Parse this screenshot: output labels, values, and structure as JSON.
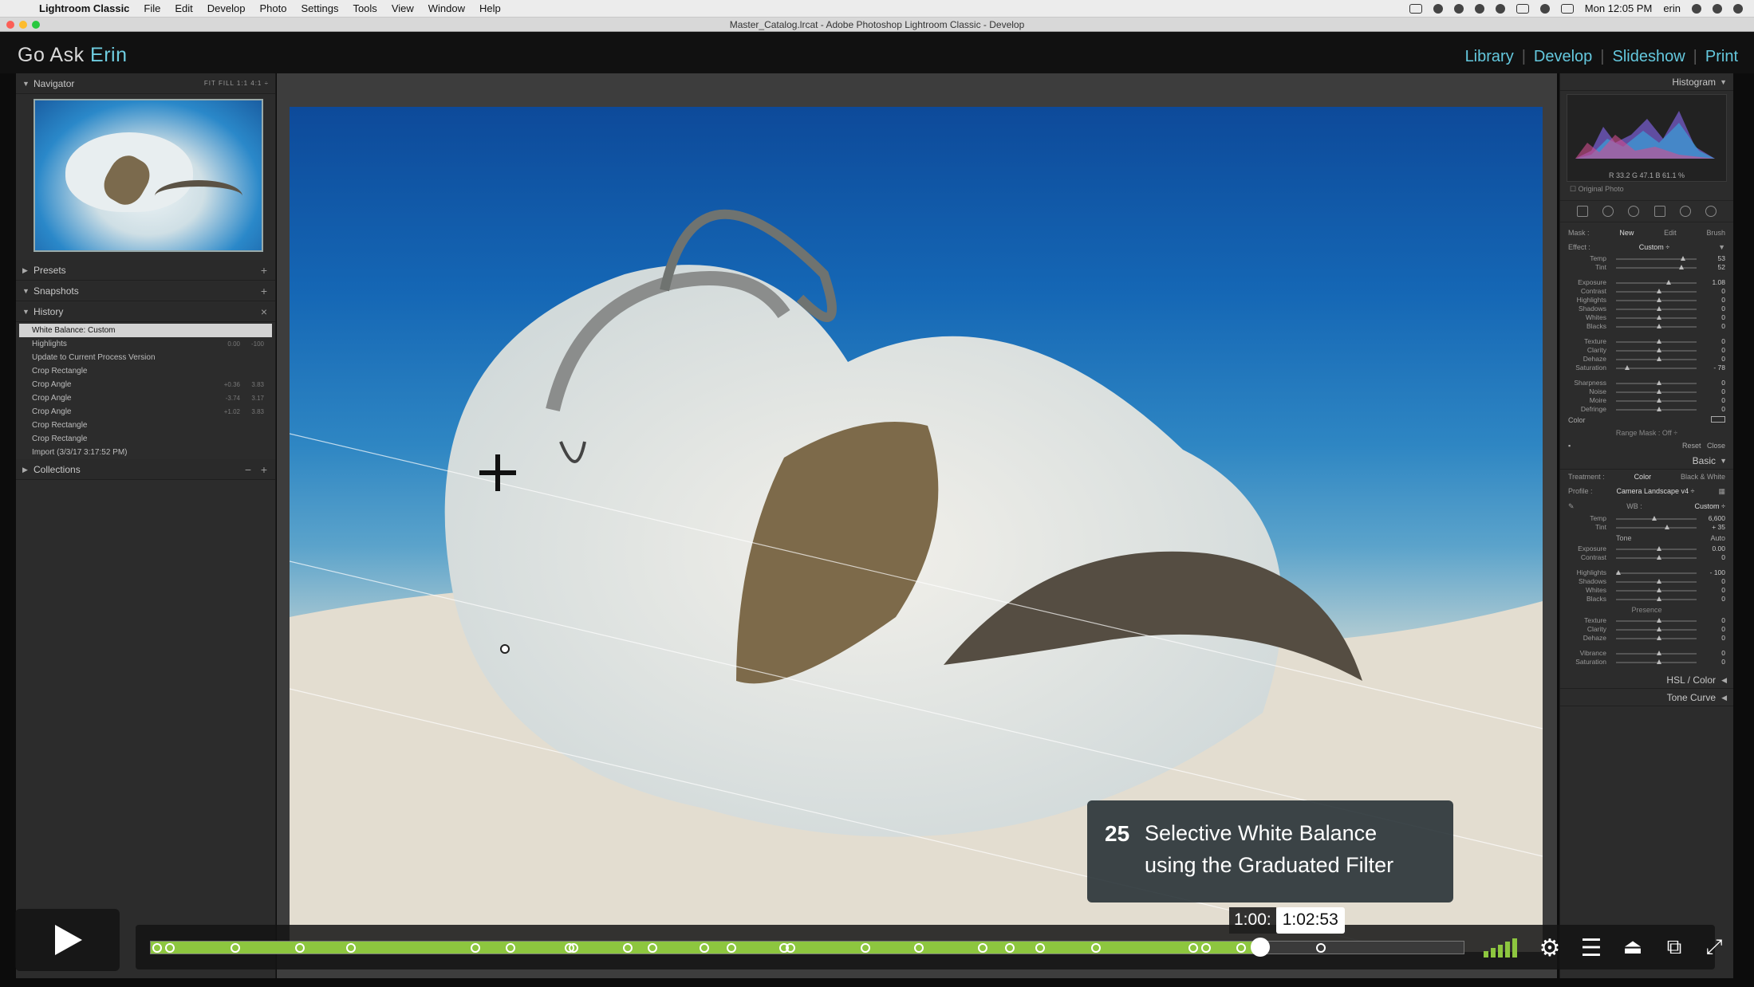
{
  "menubar": {
    "items": [
      "Lightroom Classic",
      "File",
      "Edit",
      "Develop",
      "Photo",
      "Settings",
      "Tools",
      "View",
      "Window",
      "Help"
    ],
    "clock": "Mon 12:05 PM",
    "user": "erin"
  },
  "window": {
    "title": "Master_Catalog.lrcat - Adobe Photoshop Lightroom Classic - Develop"
  },
  "identity": {
    "part1": "Go Ask ",
    "part2": "Erin"
  },
  "modules": [
    "Library",
    "Develop",
    "Slideshow",
    "Print"
  ],
  "left_panel": {
    "navigator": {
      "title": "Navigator",
      "zoom": "FIT  FILL  1:1  4:1 ÷"
    },
    "presets": "Presets",
    "snapshots": "Snapshots",
    "history": {
      "title": "History",
      "items": [
        {
          "label": "White Balance: Custom",
          "v1": "",
          "v2": ""
        },
        {
          "label": "Highlights",
          "v1": "0.00",
          "v2": "-100"
        },
        {
          "label": "Update to Current Process Version",
          "v1": "",
          "v2": ""
        },
        {
          "label": "Crop Rectangle",
          "v1": "",
          "v2": ""
        },
        {
          "label": "Crop Angle",
          "v1": "+0.36",
          "v2": "3.83"
        },
        {
          "label": "Crop Angle",
          "v1": "-3.74",
          "v2": "3.17"
        },
        {
          "label": "Crop Angle",
          "v1": "+1.02",
          "v2": "3.83"
        },
        {
          "label": "Crop Rectangle",
          "v1": "",
          "v2": ""
        },
        {
          "label": "Crop Rectangle",
          "v1": "",
          "v2": ""
        },
        {
          "label": "Import (3/3/17 3:17:52 PM)",
          "v1": "",
          "v2": ""
        }
      ]
    },
    "collections": "Collections"
  },
  "right_panel": {
    "histogram_title": "Histogram",
    "histogram_readout": "R  33.2   G  47.1   B  61.1 %",
    "original_photo": "Original Photo",
    "mask": {
      "label": "Mask :",
      "new": "New",
      "edit": "Edit",
      "brush": "Brush"
    },
    "effect": {
      "label": "Effect :",
      "value": "Custom ÷"
    },
    "sliders1": [
      {
        "label": "Temp",
        "value": "53",
        "pos": 0.8
      },
      {
        "label": "Tint",
        "value": "52",
        "pos": 0.78
      }
    ],
    "sliders2": [
      {
        "label": "Exposure",
        "value": "1.08",
        "pos": 0.62
      },
      {
        "label": "Contrast",
        "value": "0",
        "pos": 0.5
      },
      {
        "label": "Highlights",
        "value": "0",
        "pos": 0.5
      },
      {
        "label": "Shadows",
        "value": "0",
        "pos": 0.5
      },
      {
        "label": "Whites",
        "value": "0",
        "pos": 0.5
      },
      {
        "label": "Blacks",
        "value": "0",
        "pos": 0.5
      }
    ],
    "sliders3": [
      {
        "label": "Texture",
        "value": "0",
        "pos": 0.5
      },
      {
        "label": "Clarity",
        "value": "0",
        "pos": 0.5
      },
      {
        "label": "Dehaze",
        "value": "0",
        "pos": 0.5
      },
      {
        "label": "Saturation",
        "value": "- 78",
        "pos": 0.11
      }
    ],
    "sliders4": [
      {
        "label": "Sharpness",
        "value": "0",
        "pos": 0.5
      },
      {
        "label": "Noise",
        "value": "0",
        "pos": 0.5
      },
      {
        "label": "Moire",
        "value": "0",
        "pos": 0.5
      },
      {
        "label": "Defringe",
        "value": "0",
        "pos": 0.5
      }
    ],
    "color_label": "Color",
    "range_mask": "Range Mask : Off ÷",
    "reset": "Reset",
    "close": "Close",
    "basic_title": "Basic",
    "treatment": {
      "label": "Treatment :",
      "color": "Color",
      "bw": "Black & White"
    },
    "profile": {
      "label": "Profile :",
      "value": "Camera Landscape v4 ÷"
    },
    "wb": {
      "label": "WB :",
      "value": "Custom ÷"
    },
    "basic_sliders1": [
      {
        "label": "Temp",
        "value": "6,600",
        "pos": 0.45
      },
      {
        "label": "Tint",
        "value": "+ 35",
        "pos": 0.6
      }
    ],
    "tone_label": "Tone",
    "auto_label": "Auto",
    "basic_sliders2": [
      {
        "label": "Exposure",
        "value": "0.00",
        "pos": 0.5
      },
      {
        "label": "Contrast",
        "value": "0",
        "pos": 0.5
      }
    ],
    "basic_sliders3": [
      {
        "label": "Highlights",
        "value": "- 100",
        "pos": 0.0
      },
      {
        "label": "Shadows",
        "value": "0",
        "pos": 0.5
      },
      {
        "label": "Whites",
        "value": "0",
        "pos": 0.5
      },
      {
        "label": "Blacks",
        "value": "0",
        "pos": 0.5
      }
    ],
    "presence_label": "Presence",
    "basic_sliders4": [
      {
        "label": "Texture",
        "value": "0",
        "pos": 0.5
      },
      {
        "label": "Clarity",
        "value": "0",
        "pos": 0.5
      },
      {
        "label": "Dehaze",
        "value": "0",
        "pos": 0.5
      }
    ],
    "basic_sliders5": [
      {
        "label": "Vibrance",
        "value": "0",
        "pos": 0.5
      },
      {
        "label": "Saturation",
        "value": "0",
        "pos": 0.5
      }
    ],
    "hsl_title": "HSL / Color",
    "tone_curve_title": "Tone Curve"
  },
  "video": {
    "chapter_number": "25",
    "chapter_title_line1": "Selective White Balance",
    "chapter_title_line2": "using the Graduated Filter",
    "time_current": "1:00:",
    "time_hover": "1:02:53",
    "played_fraction": 0.845,
    "playhead_fraction": 0.845,
    "chapter_fractions": [
      0.0,
      0.01,
      0.06,
      0.11,
      0.149,
      0.245,
      0.272,
      0.317,
      0.32,
      0.362,
      0.381,
      0.421,
      0.442,
      0.482,
      0.487,
      0.545,
      0.586,
      0.635,
      0.656,
      0.679,
      0.722,
      0.797,
      0.807,
      0.834,
      0.895
    ]
  },
  "colors": {
    "accent": "#6fcde0",
    "progress": "#8dc63f"
  }
}
